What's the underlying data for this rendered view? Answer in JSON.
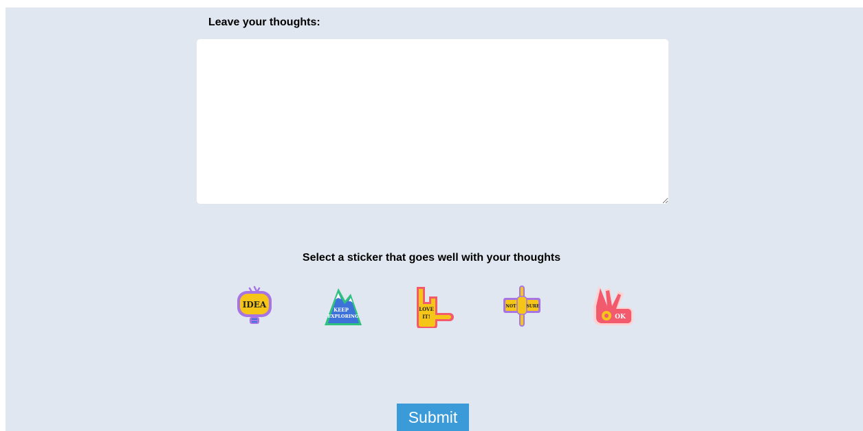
{
  "form": {
    "thoughts_label": "Leave your thoughts:",
    "thoughts_value": "",
    "sticker_prompt": "Select a sticker that goes well with your thoughts",
    "submit_label": "Submit"
  },
  "stickers": [
    {
      "icon": "idea-bulb-icon",
      "text": "IDEA"
    },
    {
      "icon": "keep-exploring-mountain-icon",
      "text_line1": "KEEP",
      "text_line2": "EXPLORING"
    },
    {
      "icon": "love-it-hand-icon",
      "text_line1": "LOVE",
      "text_line2": "IT!"
    },
    {
      "icon": "not-sure-hand-icon",
      "text_line1": "NOT",
      "text_line2": "SURE"
    },
    {
      "icon": "ok-hand-icon",
      "text": "OK"
    }
  ],
  "colors": {
    "background": "#e0e7f1",
    "submit_bg": "#3b9ad8",
    "sticker_yellow": "#f5c518",
    "sticker_purple": "#a774e3",
    "sticker_pink": "#f25a6e",
    "sticker_blue": "#3d73d9",
    "sticker_green": "#2ec27e"
  }
}
